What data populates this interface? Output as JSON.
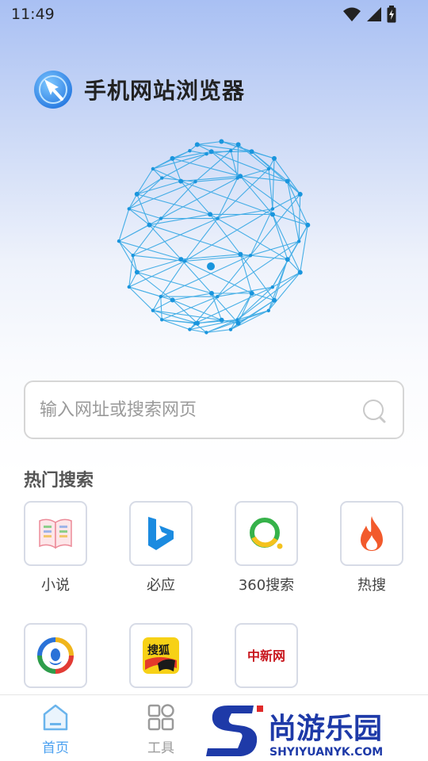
{
  "status_bar": {
    "time": "11:49",
    "icons": [
      "wifi-icon",
      "signal-icon",
      "battery-icon"
    ]
  },
  "header": {
    "app_title": "手机网站浏览器",
    "logo": "compass-logo-icon"
  },
  "search": {
    "placeholder": "输入网址或搜索网页",
    "value": ""
  },
  "hot": {
    "title": "热门搜索",
    "items": [
      {
        "label": "小说",
        "icon": "book-icon"
      },
      {
        "label": "必应",
        "icon": "bing-icon"
      },
      {
        "label": "360搜索",
        "icon": "360-search-icon"
      },
      {
        "label": "热搜",
        "icon": "flame-icon"
      },
      {
        "label": "",
        "icon": "tencent-news-icon"
      },
      {
        "label": "",
        "icon": "sohu-icon",
        "logo_text": "搜狐"
      },
      {
        "label": "",
        "icon": "chinanews-icon",
        "logo_text": "中新网"
      }
    ]
  },
  "tabs": [
    {
      "label": "首页",
      "icon": "home-icon",
      "active": true
    },
    {
      "label": "工具",
      "icon": "tools-icon",
      "active": false
    }
  ],
  "watermark": {
    "brand": "尚游乐园",
    "url": "SHYIYUANYK.COM"
  },
  "colors": {
    "accent": "#4aa0f0",
    "globe": "#29a3e3",
    "bing": "#1b8be0",
    "flame": "#f25a2c",
    "green": "#36b24a"
  }
}
